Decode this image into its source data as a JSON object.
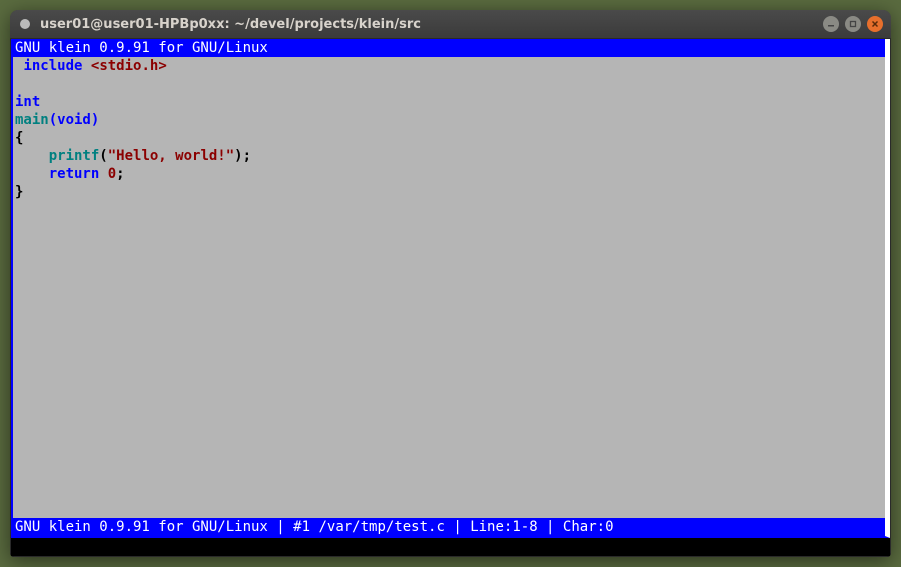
{
  "titlebar": {
    "title": "user01@user01-HPBp0xx: ~/devel/projects/klein/src"
  },
  "editor": {
    "header": "GNU klein 0.9.91 for GNU/Linux",
    "status": {
      "app": "GNU klein 0.9.91 for GNU/Linux",
      "buffer": "#1 /var/tmp/test.c",
      "line": "Line:1-8",
      "char": "Char:0"
    }
  },
  "code": {
    "l1_space": " ",
    "l1_include": "include",
    "l1_space2": " ",
    "l1_hdr": "<stdio.h>",
    "l2": "",
    "l3_int": "int",
    "l4_main": "main",
    "l4_void": "(void)",
    "l5_brace": "{",
    "l6_indent": "    ",
    "l6_printf": "printf",
    "l6_open": "(",
    "l6_str": "\"Hello, world!\"",
    "l6_close": ");",
    "l7_indent": "    ",
    "l7_return": "return",
    "l7_sp": " ",
    "l7_zero": "0",
    "l7_semi": ";",
    "l8_brace": "}"
  }
}
